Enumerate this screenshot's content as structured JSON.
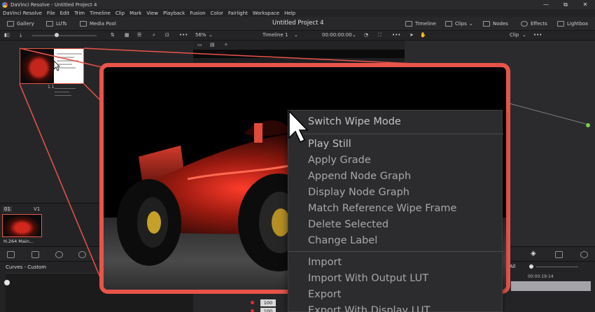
{
  "app": {
    "window_title": "DaVinci Resolve - Untitled Project 4",
    "project_title": "Untitled Project 4"
  },
  "window_controls": {
    "minimize": "—",
    "maximize": "⧉",
    "close": "✕"
  },
  "menu": [
    "DaVinci Resolve",
    "File",
    "Edit",
    "Trim",
    "Timeline",
    "Clip",
    "Mark",
    "View",
    "Playback",
    "Fusion",
    "Color",
    "Fairlight",
    "Workspace",
    "Help"
  ],
  "toolbar": {
    "gallery": "Gallery",
    "luts": "LUTs",
    "media_pool": "Media Pool",
    "timeline": "Timeline",
    "clips": "Clips",
    "nodes": "Nodes",
    "effects": "Effects",
    "lightbox": "Lightbox"
  },
  "subbar": {
    "zoom": "56%",
    "timeline_name": "Timeline 1",
    "timecode": "00:00:00:00",
    "clip_mode": "Clip",
    "more": "•••"
  },
  "gallery": {
    "still_label": "1.1"
  },
  "clip_strip": {
    "clip_number": "01",
    "track": "V1",
    "clip_name": "H.264 Main..."
  },
  "curves": {
    "title": "Curves - Custom"
  },
  "lower": {
    "value_1": "100",
    "value_2": "100",
    "timecode": "00:00:19:14",
    "all_label": "All"
  },
  "context_menu": {
    "group1": [
      "Switch Wipe Mode"
    ],
    "group2": [
      "Play Still",
      "Apply Grade",
      "Append Node Graph",
      "Display Node Graph",
      "Match Reference Wipe Frame",
      "Delete Selected",
      "Change Label"
    ],
    "group3": [
      "Import",
      "Import With Output LUT",
      "Export",
      "Export With Display LUT"
    ]
  },
  "colors": {
    "accent_red": "#e8544a",
    "node_green": "#7bd04a",
    "menu_bg": "#2c2c2e"
  }
}
